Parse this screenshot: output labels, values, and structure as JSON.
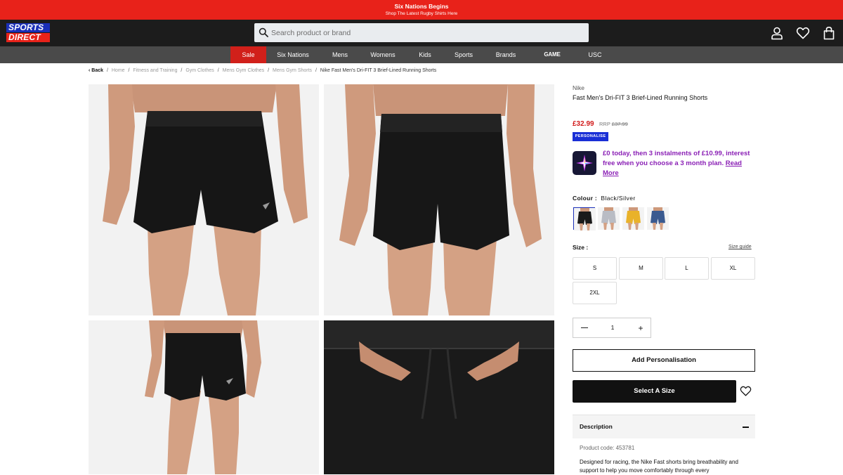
{
  "promo": {
    "title": "Six Nations Begins",
    "subtitle": "Shop The Latest Rugby Shirts Here"
  },
  "header": {
    "logo_line1": "SPORTS",
    "logo_line2": "DIRECT",
    "search_placeholder": "Search product or brand",
    "icons": [
      "account-icon",
      "heart-icon",
      "bag-icon"
    ]
  },
  "nav": {
    "items": [
      "Sale",
      "Six Nations",
      "Mens",
      "Womens",
      "Kids",
      "Sports",
      "Brands",
      "GAME",
      "USC"
    ]
  },
  "breadcrumb": {
    "back": "Back",
    "items": [
      "Home",
      "Fitness and Training",
      "Gym Clothes",
      "Mens Gym Clothes",
      "Mens Gym Shorts"
    ],
    "current": "Nike Fast Men's Dri-FIT 3 Brief-Lined Running Shorts"
  },
  "product": {
    "brand": "Nike",
    "name": "Fast Men's Dri-FIT 3 Brief-Lined Running Shorts",
    "price": "£32.99",
    "rrp_label": "RRP",
    "rrp_value": "£37.99",
    "badge": "PERSONALISE",
    "klarna_text": "£0 today, then 3 instalments of £10.99, interest free when you choose a 3 month plan.",
    "klarna_link": "Read More",
    "colour_label": "Colour :",
    "colour_value": "Black/Silver",
    "colours": [
      {
        "name": "Black/Silver",
        "color": "#1a1a1a",
        "selected": true
      },
      {
        "name": "Grey",
        "color": "#b9bcc4",
        "selected": false
      },
      {
        "name": "Yellow",
        "color": "#e9b22a",
        "selected": false
      },
      {
        "name": "Blue",
        "color": "#3a5a90",
        "selected": false
      }
    ],
    "size_label": "Size :",
    "size_guide": "Size guide",
    "sizes": [
      "S",
      "M",
      "L",
      "XL",
      "2XL"
    ],
    "quantity": "1",
    "add_personalisation": "Add Personalisation",
    "select_size": "Select A Size",
    "description_title": "Description",
    "product_code": "Product code: 453781",
    "description": "Designed for racing, the Nike Fast shorts bring breathability and support to help you move comfortably through every"
  },
  "colors": {
    "promo_red": "#e8221a",
    "nav_sale": "#d1201a",
    "header_bg": "#1c1c1c",
    "nav_bg": "#4a4a4a",
    "price_red": "#d11a1a",
    "klarna_purple": "#8a1fb5",
    "badge_blue": "#1a2fd6"
  }
}
